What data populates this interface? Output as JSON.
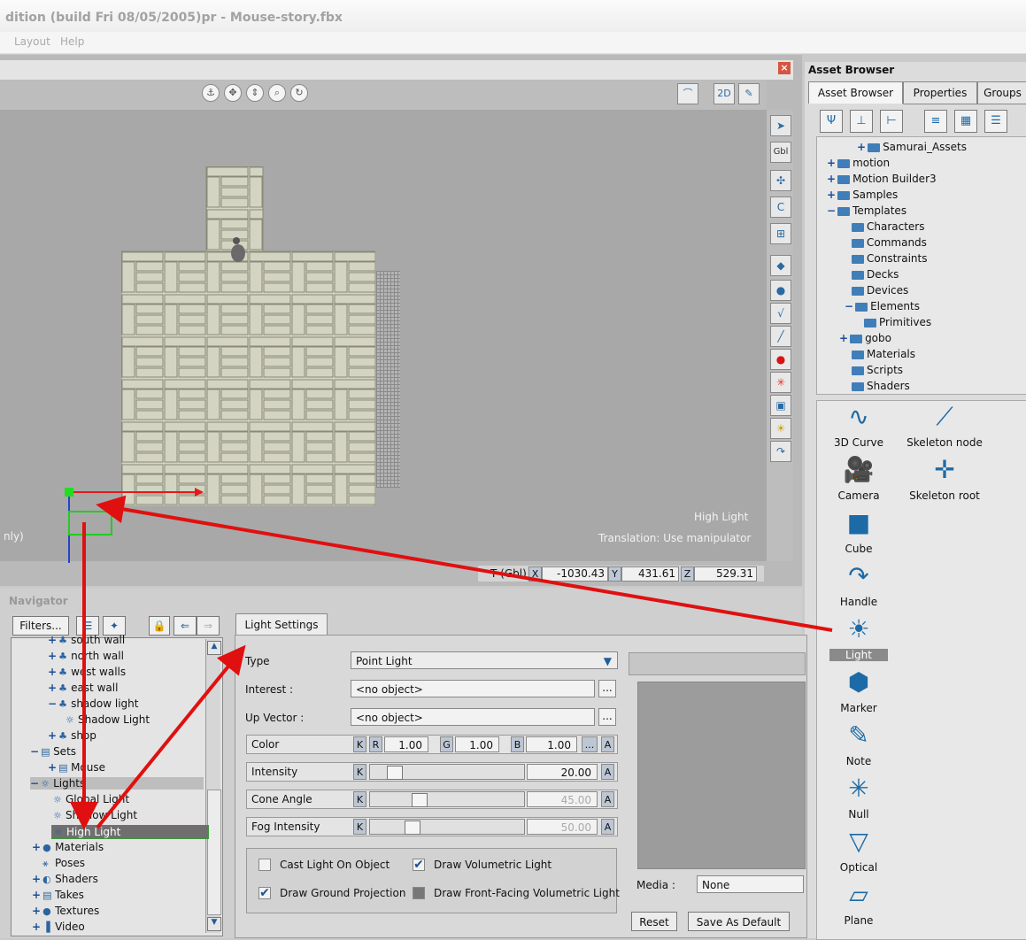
{
  "window": {
    "title": "dition (build Fri 08/05/2005)pr - Mouse-story.fbx"
  },
  "menu": {
    "items": [
      "Layout",
      "Help"
    ]
  },
  "viewer": {
    "close_glyph": "×",
    "overlay_name": "High Light",
    "overlay_mode": "Translation: Use manipulator",
    "side_text": "nly)",
    "toolbar_right": {
      "btn1": "2D"
    },
    "right_toolbar": {
      "gbl": "Gbl"
    },
    "coords": {
      "label": "T (Gbl)",
      "x_key": "X",
      "y_key": "Y",
      "z_key": "Z",
      "x": "-1030.43",
      "y": "431.61",
      "z": "529.31"
    }
  },
  "asset_browser": {
    "title": "Asset Browser",
    "tabs": [
      "Asset Browser",
      "Properties",
      "Groups"
    ],
    "tree": [
      {
        "label": "Samurai_Assets",
        "plus": "+"
      },
      {
        "label": "motion",
        "plus": "+"
      },
      {
        "label": "Motion Builder3",
        "plus": "+"
      },
      {
        "label": "Samples",
        "plus": "+"
      },
      {
        "label": "Templates",
        "plus": "−"
      },
      {
        "label": "Characters",
        "plus": ""
      },
      {
        "label": "Commands",
        "plus": ""
      },
      {
        "label": "Constraints",
        "plus": ""
      },
      {
        "label": "Decks",
        "plus": ""
      },
      {
        "label": "Devices",
        "plus": ""
      },
      {
        "label": "Elements",
        "plus": "−"
      },
      {
        "label": "Primitives",
        "plus": ""
      },
      {
        "label": "gobo",
        "plus": "+"
      },
      {
        "label": "Materials",
        "plus": ""
      },
      {
        "label": "Scripts",
        "plus": ""
      },
      {
        "label": "Shaders",
        "plus": ""
      }
    ],
    "assets": [
      {
        "label": "3D Curve",
        "icon": "curve-icon",
        "glyph": "∿"
      },
      {
        "label": "Skeleton node",
        "icon": "skeleton-node-icon",
        "glyph": "⟋"
      },
      {
        "label": "Camera",
        "icon": "camera-icon",
        "glyph": "🎥"
      },
      {
        "label": "Skeleton root",
        "icon": "skeleton-root-icon",
        "glyph": "✛"
      },
      {
        "label": "Cube",
        "icon": "cube-icon",
        "glyph": "■"
      },
      {
        "label": "Handle",
        "icon": "handle-icon",
        "glyph": "↷"
      },
      {
        "label": "Light",
        "icon": "light-icon",
        "glyph": "☀"
      },
      {
        "label": "Marker",
        "icon": "marker-icon",
        "glyph": "⬢"
      },
      {
        "label": "Note",
        "icon": "note-icon",
        "glyph": "✎"
      },
      {
        "label": "Null",
        "icon": "null-icon",
        "glyph": "✳"
      },
      {
        "label": "Optical",
        "icon": "optical-icon",
        "glyph": "▽"
      },
      {
        "label": "Plane",
        "icon": "plane-icon",
        "glyph": "▱"
      }
    ]
  },
  "navigator": {
    "title": "Navigator",
    "filters_label": "Filters...",
    "tree": [
      {
        "label": "south wall",
        "plus": "+"
      },
      {
        "label": "north wall",
        "plus": "+"
      },
      {
        "label": "west walls",
        "plus": "+"
      },
      {
        "label": "east wall",
        "plus": "+"
      },
      {
        "label": "shadow light",
        "plus": "−"
      },
      {
        "label": "Shadow Light",
        "plus": ""
      },
      {
        "label": "shop",
        "plus": "+"
      },
      {
        "label": "Sets",
        "plus": "−"
      },
      {
        "label": "Mouse",
        "plus": "+"
      },
      {
        "label": "Lights",
        "plus": "−"
      },
      {
        "label": "Global Light",
        "plus": ""
      },
      {
        "label": "Shadow Light",
        "plus": ""
      },
      {
        "label": "High Light",
        "plus": ""
      },
      {
        "label": "Materials",
        "plus": "+"
      },
      {
        "label": "Poses",
        "plus": ""
      },
      {
        "label": "Shaders",
        "plus": "+"
      },
      {
        "label": "Takes",
        "plus": "+"
      },
      {
        "label": "Textures",
        "plus": "+"
      },
      {
        "label": "Video",
        "plus": "+"
      }
    ]
  },
  "light_settings": {
    "tab": "Light Settings",
    "type_label": "Type",
    "type_value": "Point Light",
    "interest_label": "Interest :",
    "interest_value": "<no object>",
    "upvector_label": "Up Vector :",
    "upvector_value": "<no object>",
    "ellipsis": "...",
    "color_label": "Color",
    "k": "K",
    "r": "R",
    "g": "G",
    "b": "B",
    "a": "A",
    "color_r": "1.00",
    "color_g": "1.00",
    "color_b": "1.00",
    "intensity_label": "Intensity",
    "intensity": "20.00",
    "intensity_fraction": 0.12,
    "cone_label": "Cone Angle",
    "cone": "45.00",
    "cone_fraction": 0.3,
    "fog_label": "Fog Intensity",
    "fog": "50.00",
    "fog_fraction": 0.25,
    "cast_light": "Cast Light On Object",
    "cast_light_checked": false,
    "draw_volumetric": "Draw Volumetric Light",
    "draw_volumetric_checked": true,
    "draw_ground": "Draw Ground Projection",
    "draw_ground_checked": true,
    "draw_front": "Draw Front-Facing Volumetric Light",
    "draw_front_checked": false,
    "media_label": "Media :",
    "media_value": "None",
    "reset": "Reset",
    "save_default": "Save As Default"
  },
  "colors": {
    "accent": "#1c6aa6",
    "arrow": "#e01010",
    "selection": "#8a8a8a"
  }
}
